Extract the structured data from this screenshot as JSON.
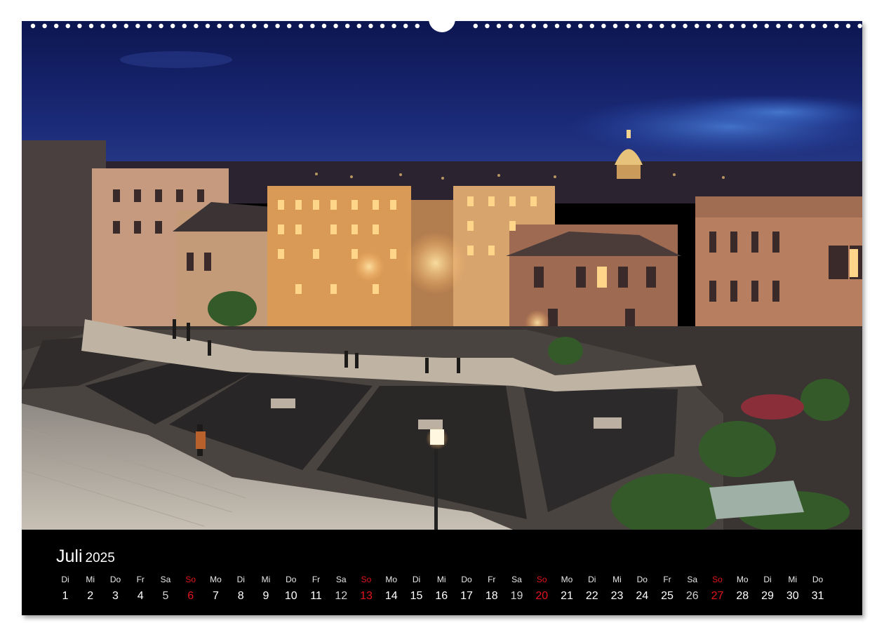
{
  "calendar": {
    "month": "Juli",
    "year": "2025",
    "weekend_color": "#e3141c",
    "days": [
      {
        "dow": "Di",
        "num": "1"
      },
      {
        "dow": "Mi",
        "num": "2"
      },
      {
        "dow": "Do",
        "num": "3"
      },
      {
        "dow": "Fr",
        "num": "4"
      },
      {
        "dow": "Sa",
        "num": "5"
      },
      {
        "dow": "So",
        "num": "6"
      },
      {
        "dow": "Mo",
        "num": "7"
      },
      {
        "dow": "Di",
        "num": "8"
      },
      {
        "dow": "Mi",
        "num": "9"
      },
      {
        "dow": "Do",
        "num": "10"
      },
      {
        "dow": "Fr",
        "num": "11"
      },
      {
        "dow": "Sa",
        "num": "12"
      },
      {
        "dow": "So",
        "num": "13"
      },
      {
        "dow": "Mo",
        "num": "14"
      },
      {
        "dow": "Di",
        "num": "15"
      },
      {
        "dow": "Mi",
        "num": "16"
      },
      {
        "dow": "Do",
        "num": "17"
      },
      {
        "dow": "Fr",
        "num": "18"
      },
      {
        "dow": "Sa",
        "num": "19"
      },
      {
        "dow": "So",
        "num": "20"
      },
      {
        "dow": "Mo",
        "num": "21"
      },
      {
        "dow": "Di",
        "num": "22"
      },
      {
        "dow": "Mi",
        "num": "23"
      },
      {
        "dow": "Do",
        "num": "24"
      },
      {
        "dow": "Fr",
        "num": "25"
      },
      {
        "dow": "Sa",
        "num": "26"
      },
      {
        "dow": "So",
        "num": "27"
      },
      {
        "dow": "Mo",
        "num": "28"
      },
      {
        "dow": "Di",
        "num": "29"
      },
      {
        "dow": "Mi",
        "num": "30"
      },
      {
        "dow": "Do",
        "num": "31"
      }
    ]
  }
}
